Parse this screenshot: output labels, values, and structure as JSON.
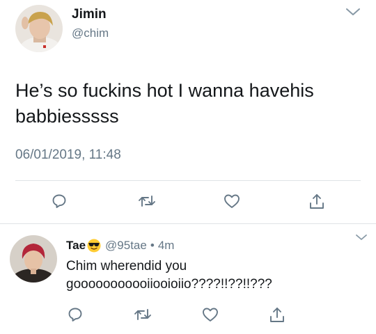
{
  "main_tweet": {
    "display_name": "Jimin",
    "handle": "@chim",
    "text": "He’s so fuckins hot I wanna havehis babbiesssss",
    "timestamp": "06/01/2019, 11:48",
    "actions": [
      "reply-icon",
      "retweet-icon",
      "like-icon",
      "share-icon"
    ]
  },
  "reply_tweet": {
    "display_name": "Tae",
    "emoji": "smiling-face-with-sunglasses",
    "handle": "@95tae",
    "separator": "•",
    "time": "4m",
    "text": "Chim wherendid you gooooooooooiiooioiio????!!??!!???",
    "actions": [
      "reply-icon",
      "retweet-icon",
      "like-icon",
      "share-icon"
    ]
  },
  "colors": {
    "text_primary": "#14171a",
    "text_secondary": "#657786",
    "divider": "#dfe3e6",
    "icon": "#657786"
  }
}
